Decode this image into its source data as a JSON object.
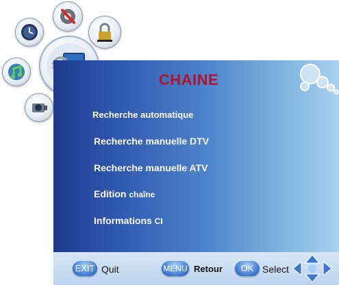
{
  "menu": {
    "title": "CHAINE",
    "items": [
      {
        "label": "Recherche automatique",
        "suffix": ""
      },
      {
        "label": "Recherche manuelle DTV",
        "suffix": ""
      },
      {
        "label": "Recherche manuelle ATV",
        "suffix": ""
      },
      {
        "label": "Edition",
        "suffix": "chaîne"
      },
      {
        "label": "Informations",
        "suffix": "CI"
      }
    ]
  },
  "top_icons": [
    {
      "name": "clock-icon"
    },
    {
      "name": "settings-tools-icon"
    },
    {
      "name": "lock-icon"
    },
    {
      "name": "music-icon"
    },
    {
      "name": "tv-dish-icon"
    },
    {
      "name": "camera-icon"
    }
  ],
  "footer": {
    "exit_key": "EXIT",
    "exit_label": "Quit",
    "menu_key": "MENU",
    "menu_label": "Retour",
    "ok_key": "OK",
    "ok_label": "Select"
  },
  "colors": {
    "title": "#b3122a",
    "panel_dark": "#1e3a8c",
    "panel_light": "#a8d1ee",
    "button": "#3b77cf"
  }
}
